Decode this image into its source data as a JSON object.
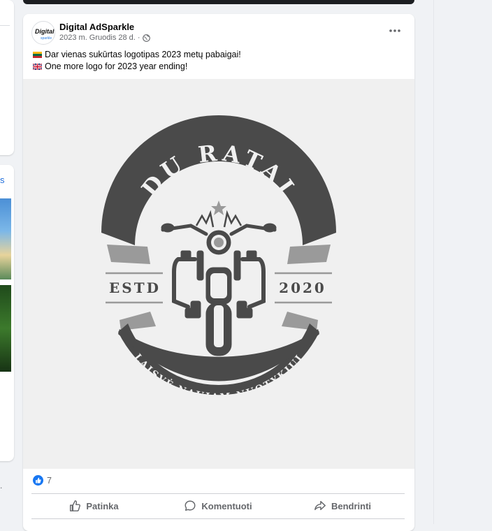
{
  "post": {
    "author": "Digital AdSparkle",
    "date": "2023 m. Gruodis 28 d.",
    "separator": "·",
    "line_lt": "Dar vienas sukūrtas logotipas 2023 metų pabaigai!",
    "line_en": "One more logo for 2023 year ending!",
    "avatar_text_top": "Digital",
    "avatar_text_bottom": "sparkle",
    "reaction_count": "7"
  },
  "logo": {
    "title": "DU RATAI",
    "estd": "ESTD",
    "year": "2020",
    "slogan": "LAISVĖ NAUJAM NUOTYKIUI",
    "color": "#4a4a4a",
    "light_color": "#9a9a9a"
  },
  "actions": {
    "like": "Patinka",
    "comment": "Komentuoti",
    "share": "Bendrinti"
  },
  "sidebar": {
    "link_fragment": "s",
    "dot": "."
  },
  "colors": {
    "accent": "#1877f2",
    "muted": "#65676b"
  }
}
